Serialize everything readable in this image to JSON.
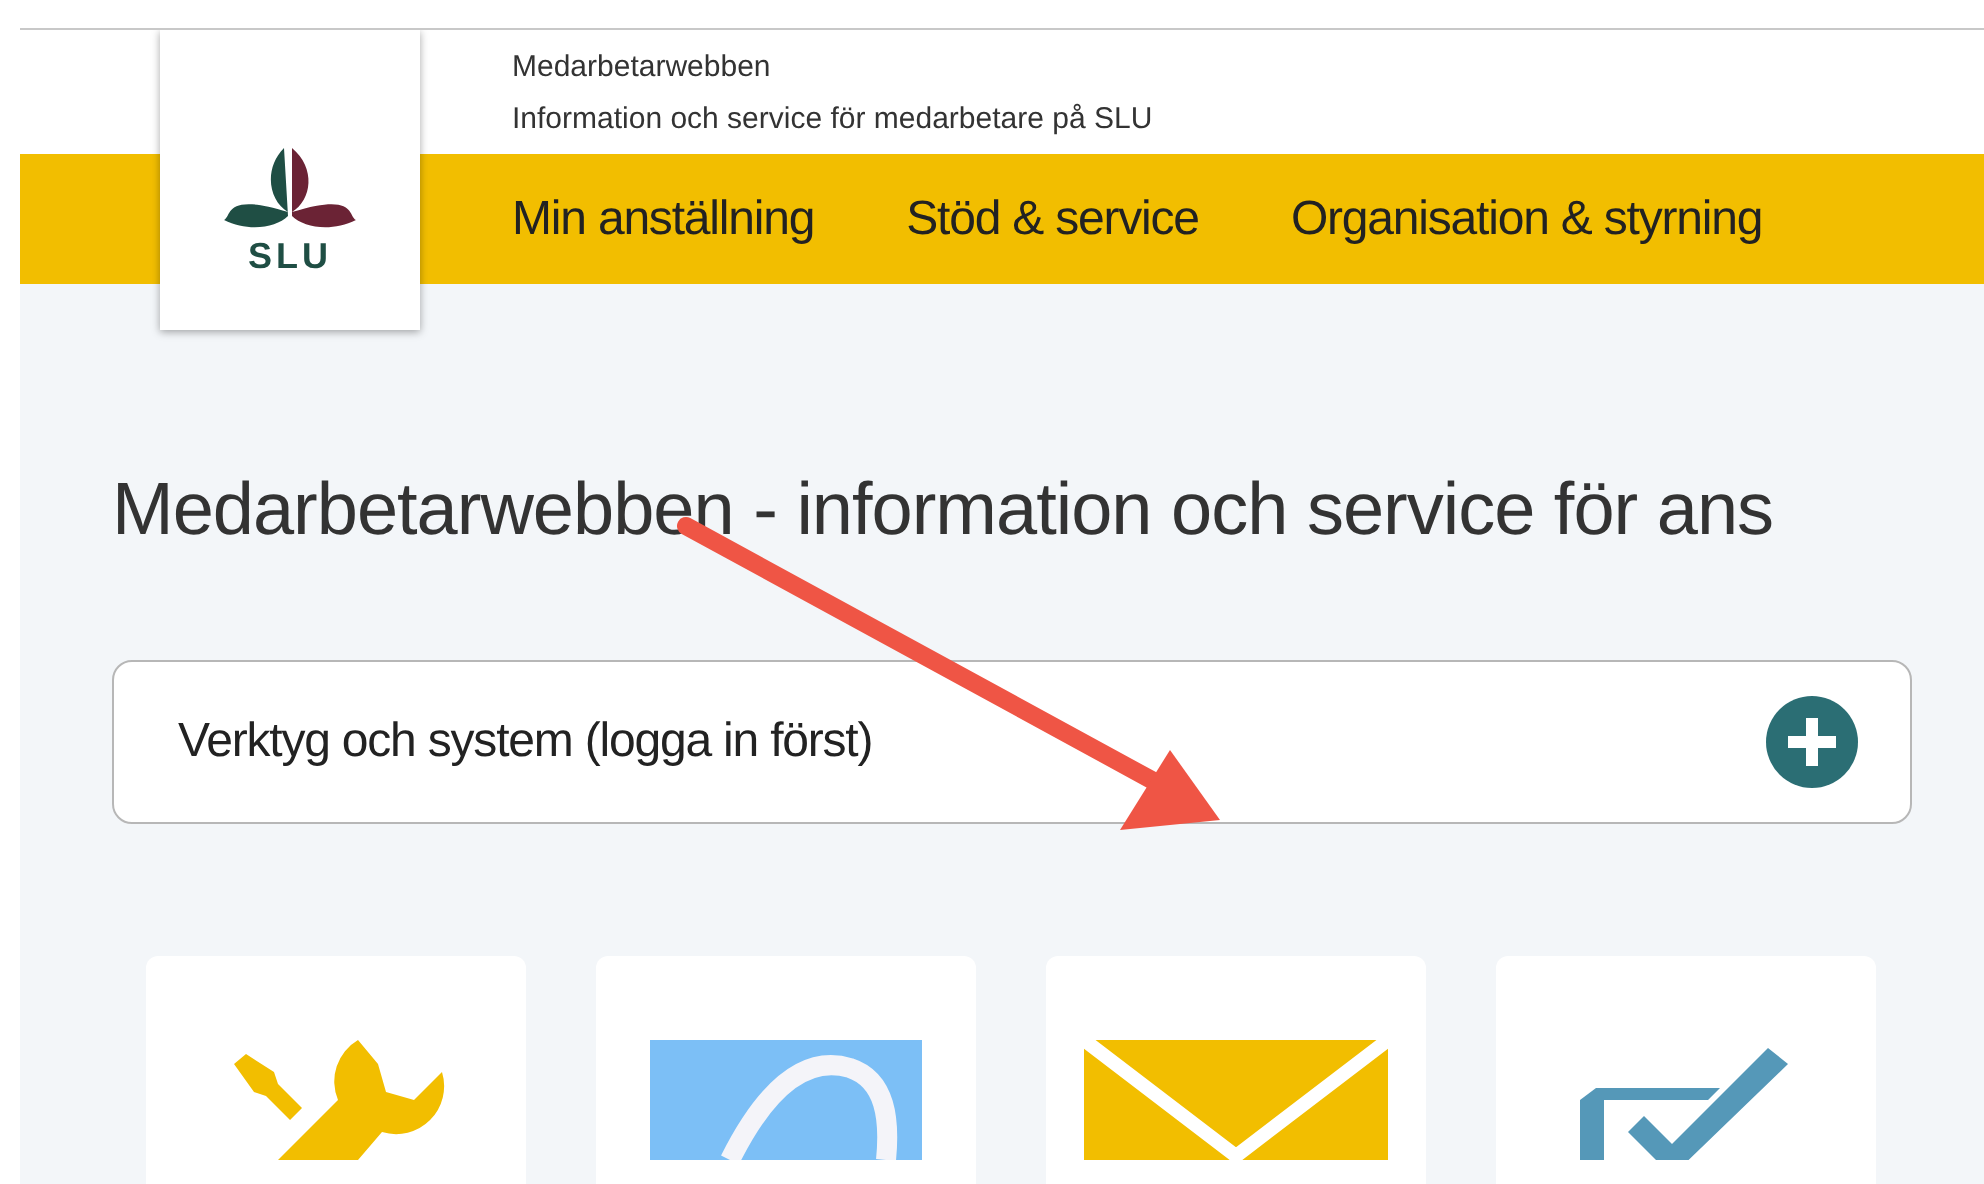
{
  "site": {
    "title": "Medarbetarwebben",
    "subtitle": "Information och service för medarbetare på SLU",
    "logo_text": "SLU"
  },
  "nav": [
    {
      "label": "Min anställning"
    },
    {
      "label": "Stöd & service"
    },
    {
      "label": "Organisation & styrning"
    }
  ],
  "heading": "Medarbetarwebben - information och service för ans",
  "accordion": {
    "label": "Verktyg och system (logga in först)",
    "expanded": false
  },
  "cards": [
    {
      "kind": "tools"
    },
    {
      "kind": "app"
    },
    {
      "kind": "mail"
    },
    {
      "kind": "check"
    }
  ]
}
